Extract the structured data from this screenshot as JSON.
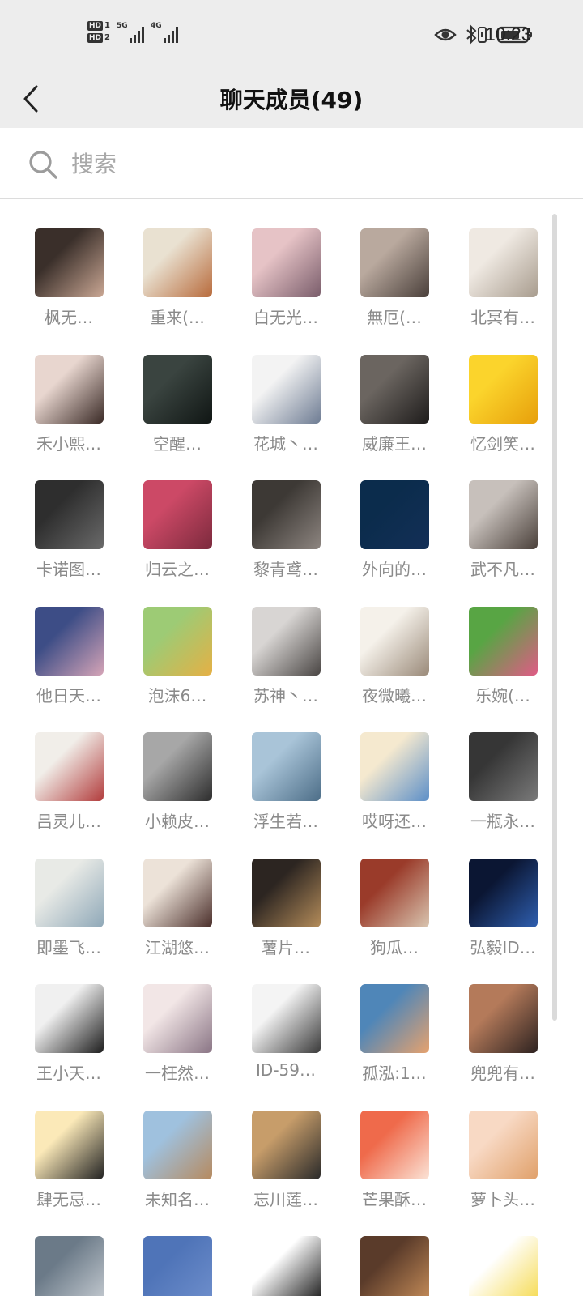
{
  "status_bar": {
    "sim1": "HD",
    "sim1_num": "1",
    "sim2": "HD",
    "sim2_num": "2",
    "net1": "5G",
    "net2": "4G",
    "time": "10:23"
  },
  "header": {
    "title": "聊天成员(49)"
  },
  "search": {
    "placeholder": "搜索",
    "value": ""
  },
  "members": [
    {
      "name": "枫无…",
      "colors": [
        "#3a2f2a",
        "#caa794"
      ]
    },
    {
      "name": "重来(…",
      "colors": [
        "#e9e1d1",
        "#b86b3c"
      ]
    },
    {
      "name": "白无光…",
      "colors": [
        "#e6c3c6",
        "#7a5d6b"
      ]
    },
    {
      "name": "無厄(…",
      "colors": [
        "#b9a99e",
        "#4a3f3a"
      ]
    },
    {
      "name": "北冥有…",
      "colors": [
        "#efe9e2",
        "#a89c8e"
      ]
    },
    {
      "name": "禾小熙…",
      "colors": [
        "#e8d6cf",
        "#3a2a26"
      ]
    },
    {
      "name": "空醒…",
      "colors": [
        "#3a4440",
        "#101614"
      ]
    },
    {
      "name": "花城丶…",
      "colors": [
        "#f3f3f3",
        "#6e7c93"
      ]
    },
    {
      "name": "威廉王…",
      "colors": [
        "#6b6560",
        "#1e1c1b"
      ]
    },
    {
      "name": "忆剑笑…",
      "colors": [
        "#fbd42c",
        "#e79f0b"
      ]
    },
    {
      "name": "卡诺图…",
      "colors": [
        "#2e2e2e",
        "#6a6a6a"
      ]
    },
    {
      "name": "归云之…",
      "colors": [
        "#cc4966",
        "#7c2a3d"
      ]
    },
    {
      "name": "黎青鸢…",
      "colors": [
        "#3d3935",
        "#8d8580"
      ]
    },
    {
      "name": "外向的…",
      "colors": [
        "#0b2c4c",
        "#132f57"
      ]
    },
    {
      "name": "武不凡…",
      "colors": [
        "#c7c0bb",
        "#4a403a"
      ]
    },
    {
      "name": "他日天…",
      "colors": [
        "#3d4d86",
        "#d5a4b7"
      ]
    },
    {
      "name": "泡沫6…",
      "colors": [
        "#9dcb75",
        "#e5b045"
      ]
    },
    {
      "name": "苏神丶…",
      "colors": [
        "#d8d5d3",
        "#4a4644"
      ]
    },
    {
      "name": "夜微曦…",
      "colors": [
        "#f5f1ea",
        "#9a8a79"
      ]
    },
    {
      "name": "乐婉(…",
      "colors": [
        "#58a544",
        "#e05b86"
      ]
    },
    {
      "name": "吕灵儿…",
      "colors": [
        "#f1eee9",
        "#b23c3c"
      ]
    },
    {
      "name": "小赖皮…",
      "colors": [
        "#a7a7a7",
        "#2d2d2d"
      ]
    },
    {
      "name": "浮生若…",
      "colors": [
        "#a9c4d8",
        "#4d6e88"
      ]
    },
    {
      "name": "哎呀还…",
      "colors": [
        "#f5e9cf",
        "#5c8fc8"
      ]
    },
    {
      "name": "一瓶永…",
      "colors": [
        "#363636",
        "#7a7a7a"
      ]
    },
    {
      "name": "即墨飞…",
      "colors": [
        "#e8eae6",
        "#8fa8b8"
      ]
    },
    {
      "name": "江湖悠…",
      "colors": [
        "#ece2d8",
        "#4a2e2a"
      ]
    },
    {
      "name": "薯片…",
      "colors": [
        "#2c2521",
        "#b48c5a"
      ]
    },
    {
      "name": "狗瓜…",
      "colors": [
        "#9a3b2a",
        "#d9c5b0"
      ]
    },
    {
      "name": "弘毅ID…",
      "colors": [
        "#0b1633",
        "#2f5fb0"
      ]
    },
    {
      "name": "王小天…",
      "colors": [
        "#f0f0f0",
        "#1d1d1d"
      ]
    },
    {
      "name": "一枉然…",
      "colors": [
        "#f2e6e6",
        "#8a7585"
      ]
    },
    {
      "name": "ID-59…",
      "colors": [
        "#f4f4f4",
        "#3a3a3a"
      ]
    },
    {
      "name": "孤泓:1…",
      "colors": [
        "#4f86b8",
        "#e6a26e"
      ]
    },
    {
      "name": "兜兜有…",
      "colors": [
        "#b47a5a",
        "#2d2220"
      ]
    },
    {
      "name": "肆无忌…",
      "colors": [
        "#fbe9b8",
        "#222222"
      ]
    },
    {
      "name": "未知名…",
      "colors": [
        "#9fc1de",
        "#b68a5f"
      ]
    },
    {
      "name": "忘川莲…",
      "colors": [
        "#c79d6a",
        "#2a2a2a"
      ]
    },
    {
      "name": "芒果酥…",
      "colors": [
        "#ef6a4b",
        "#fbe3d6"
      ]
    },
    {
      "name": "萝卜头…",
      "colors": [
        "#f8d9c4",
        "#e0a06a"
      ]
    },
    {
      "name": "",
      "colors": [
        "#6b7a88",
        "#c6ccd2"
      ]
    },
    {
      "name": "",
      "colors": [
        "#4f74b8",
        "#6f8fcc"
      ]
    },
    {
      "name": "",
      "colors": [
        "#ffffff",
        "#111111"
      ]
    },
    {
      "name": "",
      "colors": [
        "#5a3b2a",
        "#c98f5a"
      ]
    },
    {
      "name": "",
      "colors": [
        "#ffffff",
        "#f5d94a"
      ]
    }
  ]
}
